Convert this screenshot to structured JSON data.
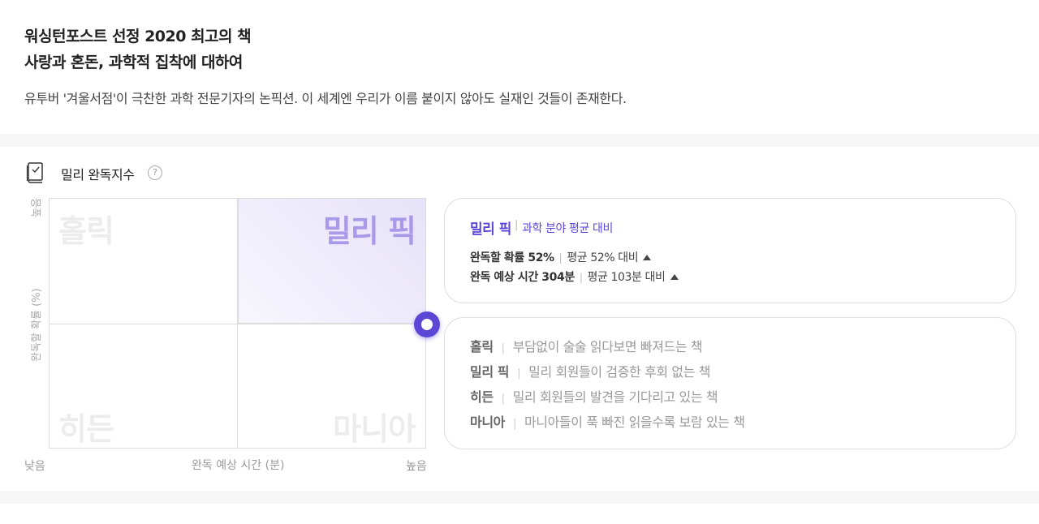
{
  "header": {
    "title_line1": "워싱턴포스트 선정 2020 최고의 책",
    "title_line2": "사랑과 혼돈, 과학적 집착에 대하여",
    "description": "유투버 '겨울서점'이 극찬한 과학 전문기자의 논픽션. 이 세계엔 우리가 이름 붙이지 않아도 실재인 것들이 존재한다."
  },
  "section": {
    "title": "밀리 완독지수",
    "help_glyph": "?",
    "icon": "book-check-icon"
  },
  "quadrant": {
    "top_left": "홀릭",
    "top_right": "밀리 픽",
    "bottom_left": "히든",
    "bottom_right": "마니아",
    "y_high": "높음",
    "y_axis": "완독할 확률 (%)",
    "x_low": "낮음",
    "x_axis": "완독 예상 시간 (분)",
    "x_high": "높음",
    "highlight_quadrant": "밀리 픽",
    "accent_color": "#5b46d6",
    "marker": {
      "completion_probability_pct": 52,
      "expected_minutes": 304
    }
  },
  "summary": {
    "category": "밀리 픽",
    "compare_label": "과학 분야 평균 대비",
    "row1": {
      "label": "완독할 확률 52%",
      "compare": "평균 52% 대비"
    },
    "row2": {
      "label": "완독 예상 시간 304분",
      "compare": "평균 103분 대비"
    }
  },
  "legend": [
    {
      "name": "홀릭",
      "desc": "부담없이 술술 읽다보면 빠져드는 책"
    },
    {
      "name": "밀리 픽",
      "desc": "밀리 회원들이 검증한 후회 없는 책"
    },
    {
      "name": "히든",
      "desc": "밀리 회원들의 발견을 기다리고 있는 책"
    },
    {
      "name": "마니아",
      "desc": "마니아들이 푹 빠진 읽을수록 보람 있는 책"
    }
  ]
}
